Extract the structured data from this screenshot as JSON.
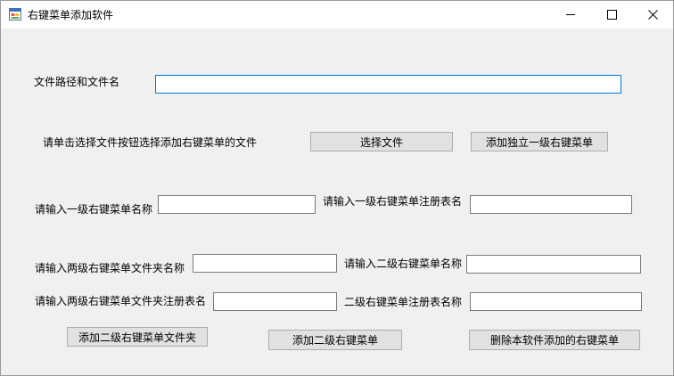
{
  "window": {
    "title": "右键菜单添加软件",
    "icon": "form-app-icon",
    "controls": {
      "minimize": "minimize-icon",
      "maximize": "maximize-icon",
      "close": "close-icon"
    }
  },
  "form": {
    "file_path_label": "文件路径和文件名",
    "file_path_value": "",
    "instruction_label": "请单击选择文件按钮选择添加右键菜单的文件",
    "select_file_button": "选择文件",
    "add_standalone_button": "添加独立一级右键菜单",
    "level1_name_label": "请输入一级右键菜单名称",
    "level1_name_value": "",
    "level1_registry_label": "请输入一级右键菜单注册表名",
    "level1_registry_value": "",
    "folder_name_label": "请输入两级右键菜单文件夹名称",
    "folder_name_value": "",
    "level2_name_label": "请输入二级右键菜单名称",
    "level2_name_value": "",
    "folder_registry_label": "请输入两级右键菜单文件夹注册表名",
    "folder_registry_value": "",
    "level2_registry_label": "二级右键菜单注册表名称",
    "level2_registry_value": "",
    "add_folder_button": "添加二级右键菜单文件夹",
    "add_level2_button": "添加二级右键菜单",
    "delete_button": "删除本软件添加的右键菜单"
  }
}
